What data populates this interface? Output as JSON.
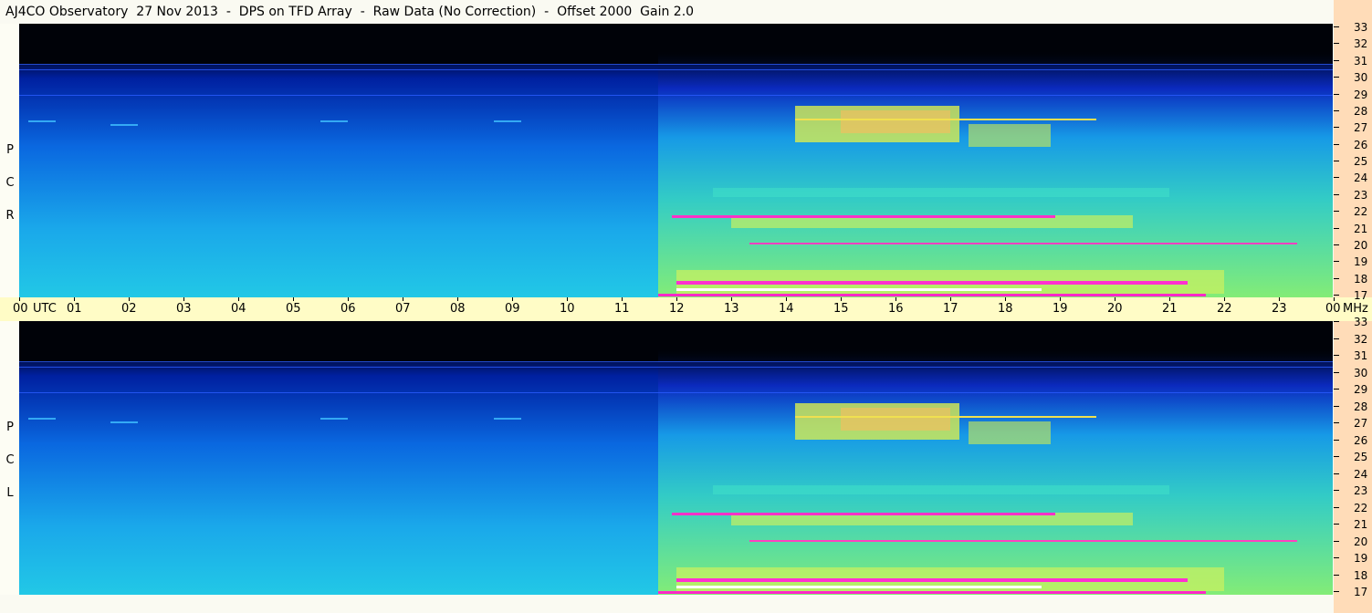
{
  "title": "AJ4CO Observatory  27 Nov 2013  -  DPS on TFD Array  -  Raw Data (No Correction)  -  Offset 2000  Gain 2.0",
  "panels": [
    {
      "id": "rcp",
      "letters": [
        "R",
        "C",
        "P"
      ]
    },
    {
      "id": "lcp",
      "letters": [
        "L",
        "C",
        "P"
      ]
    }
  ],
  "time_axis": {
    "start_label": "00",
    "utc_label": "UTC",
    "hours": [
      "01",
      "02",
      "03",
      "04",
      "05",
      "06",
      "07",
      "08",
      "09",
      "10",
      "11",
      "12",
      "13",
      "14",
      "15",
      "16",
      "17",
      "18",
      "19",
      "20",
      "21",
      "22",
      "23"
    ],
    "end_label": "00",
    "mhz_label": "MHz"
  },
  "frequency_axis": {
    "labels": [
      "33",
      "32",
      "31",
      "30",
      "29",
      "28",
      "27",
      "26",
      "25",
      "24",
      "23",
      "22",
      "21",
      "20",
      "19",
      "18",
      "17"
    ]
  },
  "colors": {
    "background": "#fafaf2",
    "axis_band": "#fffcc6",
    "scale_band": "#ffdcb8",
    "spectro_dark": "#000814",
    "spectro_blue": "#0a4fe0",
    "spectro_cyan": "#1cb8ec",
    "spectro_yellow": "#e6f04a",
    "spectro_magenta": "#ff28c8"
  }
}
